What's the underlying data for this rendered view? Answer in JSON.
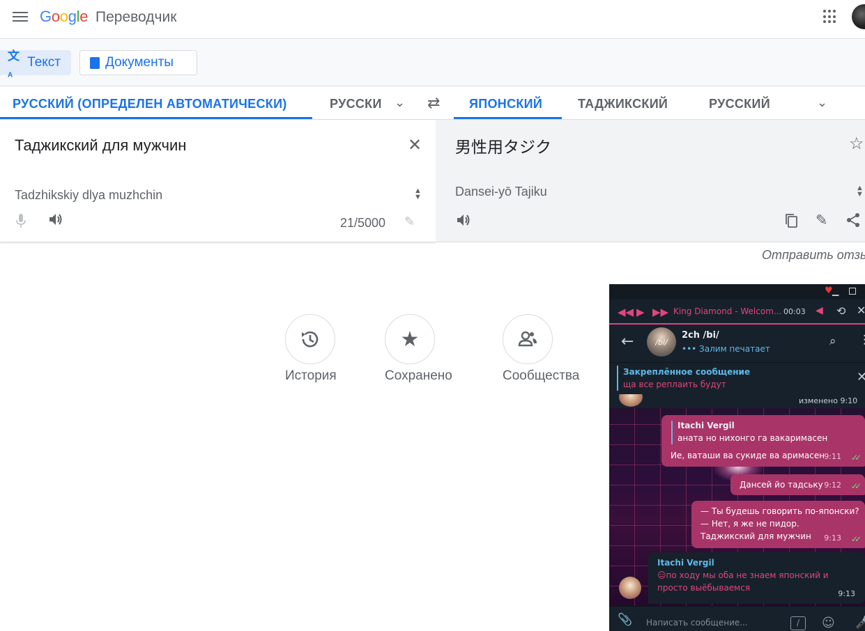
{
  "header": {
    "logo_letters": [
      "G",
      "o",
      "o",
      "g",
      "l",
      "e"
    ],
    "product": "Переводчик"
  },
  "modes": {
    "text": "Текст",
    "documents": "Документы"
  },
  "languages": {
    "source_detected": "РУССКИЙ (ОПРЕДЕЛЕН АВТОМАТИЧЕСКИ)",
    "source_option": "РУССКИ",
    "target_active": "ЯПОНСКИЙ",
    "target_option_1": "ТАДЖИКСКИЙ",
    "target_option_2": "РУССКИЙ"
  },
  "source": {
    "text": "Таджикский для мужчин",
    "transliteration": "Tadzhikskiy dlya muzhchin",
    "char_count": "21/5000"
  },
  "target": {
    "text": "男性用タジク",
    "transliteration": "Dansei-yō Tajiku"
  },
  "feedback": "Отправить отзыв",
  "actions": {
    "history": "История",
    "saved": "Сохранено",
    "communities": "Сообщества"
  },
  "telegram": {
    "player": {
      "track": "King Diamond - Welcom...",
      "time": "00:03"
    },
    "chat": {
      "name": "2ch /bi/",
      "avatar_text": "/bi/",
      "typing": "••• Залим печатает"
    },
    "pinned": {
      "title": "Закреплённое сообщение",
      "text": "ща все реплаить будут"
    },
    "edited": "изменено 9:10",
    "messages": [
      {
        "quote_name": "Itachi Vergil",
        "quote_text": "аната но нихонго га вакаримасен",
        "text": "Ие, ваташи ва сукиде ва аримасен",
        "time": "9:11"
      },
      {
        "text": "Дансей йо тадську",
        "time": "9:12"
      },
      {
        "text": "— Ты будешь говорить по-японски?\n— Нет, я же не пидор.\nТаджикский для мужчин",
        "time": "9:13"
      },
      {
        "name": "Itachi Vergil",
        "text": "😑по ходу мы оба не знаем японский и просто выёбываемся",
        "time": "9:13"
      }
    ],
    "input_placeholder": "Написать сообщение...",
    "cmd_icon": "/"
  },
  "colors": {
    "accent_blue": "#1a73e8",
    "telegram_pink": "#e0467c",
    "telegram_bubble": "#a93468",
    "telegram_bg": "#17212b"
  }
}
